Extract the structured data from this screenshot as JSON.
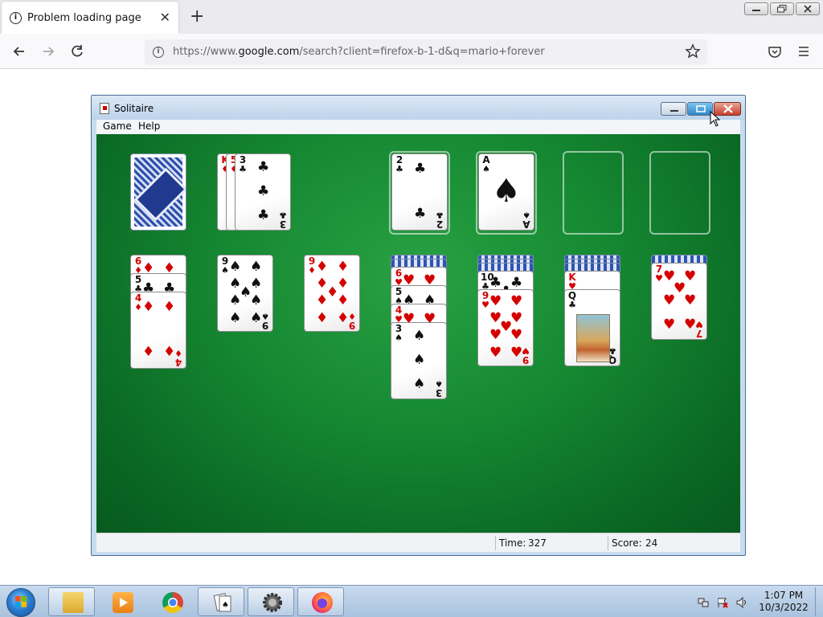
{
  "browser": {
    "tab_title": "Problem loading page",
    "url_prefix": "https://www.",
    "url_domain": "google.com",
    "url_rest": "/search?client=firefox-b-1-d&q=mario+forever"
  },
  "window": {
    "title": "Solitaire",
    "menu": [
      "Game",
      "Help"
    ]
  },
  "status": {
    "time_label": "Time:",
    "time_value": "327",
    "score_label": "Score:",
    "score_value": "24"
  },
  "game": {
    "stock": "face-down",
    "waste": [
      {
        "rank": "K",
        "suit": "♦",
        "color": "red"
      },
      {
        "rank": "5",
        "suit": "♦",
        "color": "red"
      },
      {
        "rank": "3",
        "suit": "♣",
        "color": "black"
      }
    ],
    "foundations": [
      {
        "rank": "2",
        "suit": "♣",
        "color": "black"
      },
      {
        "rank": "A",
        "suit": "♠",
        "color": "black"
      },
      null,
      null
    ],
    "tableau": [
      {
        "hidden": 0,
        "cards": [
          {
            "rank": "6",
            "suit": "♦",
            "color": "red"
          },
          {
            "rank": "5",
            "suit": "♣",
            "color": "black"
          },
          {
            "rank": "4",
            "suit": "♦",
            "color": "red"
          }
        ]
      },
      {
        "hidden": 0,
        "cards": [
          {
            "rank": "9",
            "suit": "♠",
            "color": "black"
          }
        ]
      },
      {
        "hidden": 0,
        "cards": [
          {
            "rank": "9",
            "suit": "♦",
            "color": "red"
          }
        ]
      },
      {
        "hidden": 2,
        "cards": [
          {
            "rank": "6",
            "suit": "♥",
            "color": "red"
          },
          {
            "rank": "5",
            "suit": "♠",
            "color": "black"
          },
          {
            "rank": "4",
            "suit": "♥",
            "color": "red"
          },
          {
            "rank": "3",
            "suit": "♠",
            "color": "black"
          }
        ]
      },
      {
        "hidden": 3,
        "cards": [
          {
            "rank": "10",
            "suit": "♣",
            "color": "black"
          },
          {
            "rank": "9",
            "suit": "♥",
            "color": "red"
          }
        ]
      },
      {
        "hidden": 3,
        "cards": [
          {
            "rank": "K",
            "suit": "♥",
            "color": "red"
          },
          {
            "rank": "Q",
            "suit": "♣",
            "color": "black"
          }
        ]
      },
      {
        "hidden": 1,
        "cards": [
          {
            "rank": "7",
            "suit": "♥",
            "color": "red"
          }
        ]
      }
    ]
  },
  "taskbar": {
    "clock_time": "1:07 PM",
    "clock_date": "10/3/2022",
    "pinned": [
      "start-orb",
      "file-explorer-icon",
      "media-player-icon",
      "chrome-icon",
      "solitaire-icon",
      "gear-icon",
      "firefox-icon"
    ]
  }
}
